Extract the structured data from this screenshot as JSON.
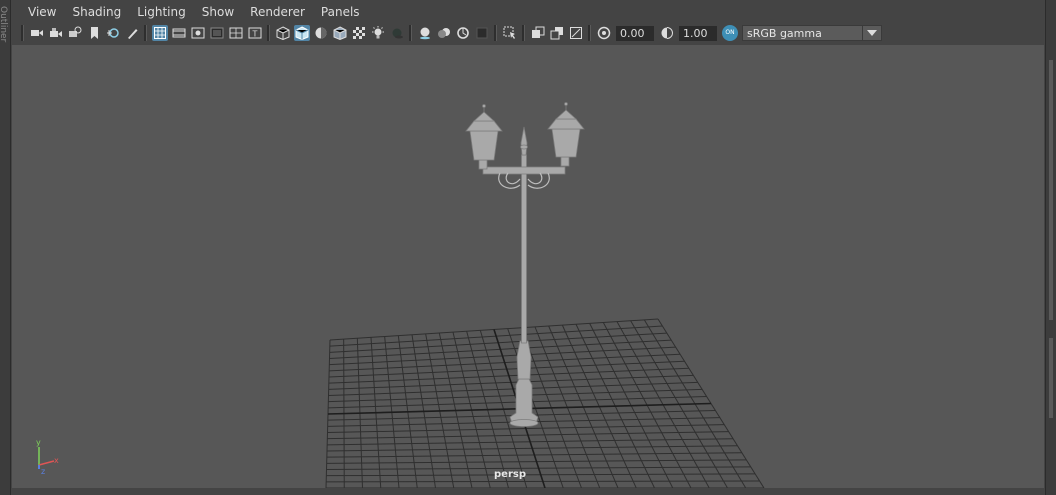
{
  "left_strip_text": "Outliner",
  "menubar": {
    "items": [
      "View",
      "Shading",
      "Lighting",
      "Show",
      "Renderer",
      "Panels"
    ]
  },
  "toolbar": {
    "exposure_value": "0.00",
    "gamma_value": "1.00",
    "color_management_badge": "ON",
    "colorspace_selected": "sRGB gamma",
    "icons": [
      "select-camera-icon",
      "camera-attributes-icon",
      "bookmarks-icon",
      "image-plane-icon",
      "2d-pan-zoom-icon",
      "grease-pencil-icon",
      "grid-icon",
      "film-gate-icon",
      "resolution-gate-icon",
      "gate-mask-icon",
      "field-chart-icon",
      "safe-action-icon",
      "wireframe-icon",
      "smooth-shade-icon",
      "default-material-icon",
      "wireframe-on-shaded-icon",
      "textured-icon",
      "use-all-lights-icon",
      "shadows-icon",
      "screen-space-ao-icon",
      "motion-blur-icon",
      "anti-aliasing-icon",
      "depth-of-field-icon",
      "isolate-select-icon",
      "xray-icon",
      "xray-active-icon",
      "xray-joints-icon",
      "exposure-icon",
      "gamma-icon",
      "color-management-icon"
    ],
    "active_icons": [
      "grid-icon",
      "smooth-shade-icon"
    ]
  },
  "viewport": {
    "camera_label": "persp",
    "axis_labels": {
      "x": "x",
      "y": "y",
      "z": "z"
    },
    "background_color": "#575757",
    "grid_color": "#2f2f2f",
    "model_color": "#a9a9a9"
  }
}
